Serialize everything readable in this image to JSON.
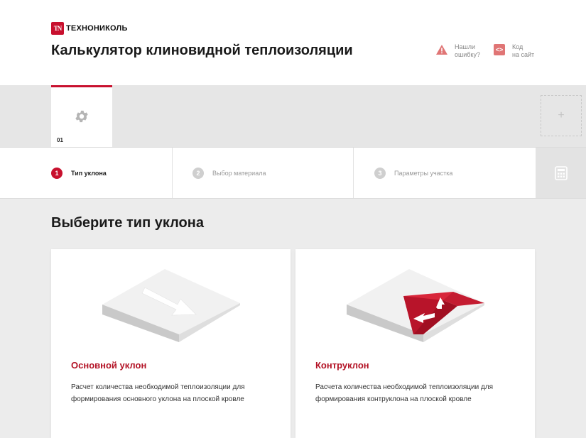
{
  "brand": {
    "logo_mark": "TN",
    "logo_text": "ТЕХНОНИКОЛЬ"
  },
  "header": {
    "title": "Калькулятор клиновидной теплоизоляции",
    "report_error": {
      "line1": "Нашли",
      "line2": "ошибку?",
      "icon": "warning-icon"
    },
    "site_code": {
      "line1": "Код",
      "line2": "на сайт",
      "icon": "code-icon"
    }
  },
  "tabs": [
    {
      "number": "01",
      "icon": "gear-icon",
      "active": true
    }
  ],
  "add_tab": {
    "label": "+"
  },
  "steps": [
    {
      "number": "1",
      "label": "Тип уклона",
      "active": true
    },
    {
      "number": "2",
      "label": "Выбор материала",
      "active": false
    },
    {
      "number": "3",
      "label": "Параметры участка",
      "active": false
    }
  ],
  "calculator": {
    "icon": "calculator-icon"
  },
  "main": {
    "title": "Выберите тип уклона",
    "options": [
      {
        "title": "Основной уклон",
        "description": "Расчет количества необходимой теплоизоляции для формирования основного уклона на плоской кровле"
      },
      {
        "title": "Контруклон",
        "description": "Расчета количества необходимой теплоизоляции для формирования контруклона на плоской кровле"
      }
    ]
  },
  "colors": {
    "accent": "#c8102e",
    "accent_text": "#b31225",
    "muted": "#999999",
    "background": "#ececec"
  }
}
